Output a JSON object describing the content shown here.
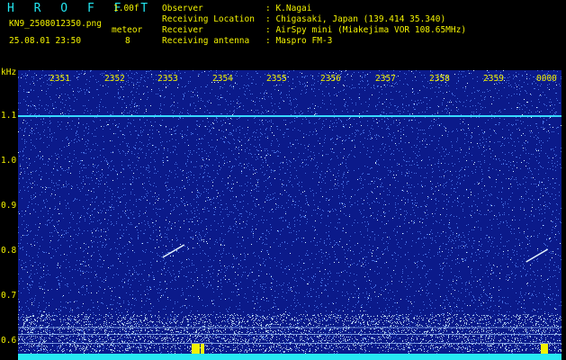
{
  "header": {
    "brand": "H R O F F T",
    "version": "1.00f",
    "filename": "KN9_2508012350.png",
    "mode_label": "meteor",
    "datetime": "25.08.01 23:50",
    "count": "8"
  },
  "station": {
    "observer_label": "Observer",
    "observer_value": ": K.Nagai",
    "location_label": "Receiving Location",
    "location_value": ": Chigasaki, Japan (139.414 35.340)",
    "receiver_label": "Receiver",
    "receiver_value": ": AirSpy mini (Miakejima VOR 108.65MHz)",
    "antenna_label": "Receiving antenna",
    "antenna_value": ": Maspro FM-3"
  },
  "chart_data": {
    "type": "heatmap",
    "ylabel": "kHz",
    "y_ticks": [
      "1.1",
      "1.0",
      "0.9",
      "0.8",
      "0.7",
      "0.6"
    ],
    "ylim": [
      0.58,
      1.17
    ],
    "x_ticks": [
      "2351",
      "2352",
      "2353",
      "2354",
      "2355",
      "2356",
      "2357",
      "2358",
      "2359",
      "0000"
    ],
    "colors": {
      "background": "#0b1a8a",
      "noise_light": "#5a8cff",
      "noise_bright": "#d6f4ff",
      "carrier": "#37d9ff",
      "labels": "#f2f200"
    },
    "carrier_khz": 1.1,
    "noise_band_khz": [
      0.6,
      0.66
    ],
    "meteor_echoes": [
      {
        "x_time": "2353.3",
        "y_khz": 0.8
      },
      {
        "x_time": "2359.9",
        "y_khz": 0.79
      }
    ]
  }
}
